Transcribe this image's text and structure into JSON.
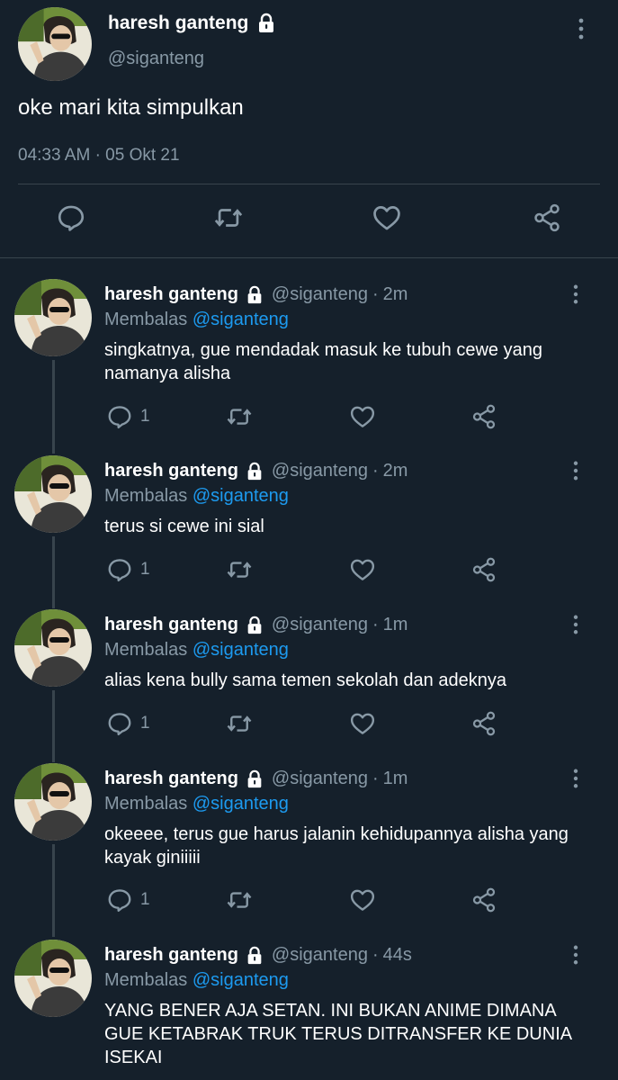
{
  "main_tweet": {
    "name": "haresh ganteng",
    "handle": "@siganteng",
    "text": "oke mari kita simpulkan",
    "time": "04:33 AM",
    "separator": "·",
    "date": "05 Okt 21"
  },
  "replying_label": "Membalas",
  "replies": [
    {
      "name": "haresh ganteng",
      "handle": "@siganteng",
      "time": "2m",
      "replying_to": "@siganteng",
      "text": "singkatnya, gue mendadak masuk ke tubuh cewe yang namanya alisha",
      "reply_count": "1"
    },
    {
      "name": "haresh ganteng",
      "handle": "@siganteng",
      "time": "2m",
      "replying_to": "@siganteng",
      "text": "terus si cewe ini sial",
      "reply_count": "1"
    },
    {
      "name": "haresh ganteng",
      "handle": "@siganteng",
      "time": "1m",
      "replying_to": "@siganteng",
      "text": "alias kena bully sama temen sekolah dan adeknya",
      "reply_count": "1"
    },
    {
      "name": "haresh ganteng",
      "handle": "@siganteng",
      "time": "1m",
      "replying_to": "@siganteng",
      "text": "okeeee, terus gue harus jalanin kehidupannya alisha yang kayak giniiiii",
      "reply_count": "1"
    },
    {
      "name": "haresh ganteng",
      "handle": "@siganteng",
      "time": "44s",
      "replying_to": "@siganteng",
      "text": "YANG BENER AJA SETAN. INI BUKAN ANIME DIMANA GUE KETABRAK TRUK TERUS DITRANSFER KE DUNIA ISEKAI",
      "reply_count": ""
    }
  ],
  "colors": {
    "background": "#15202b",
    "secondary_text": "#8899a6",
    "link": "#1d9bf0",
    "divider": "#38444d"
  },
  "icons": [
    "lock-icon",
    "more-vertical-icon",
    "reply-icon",
    "retweet-icon",
    "like-icon",
    "share-icon"
  ]
}
